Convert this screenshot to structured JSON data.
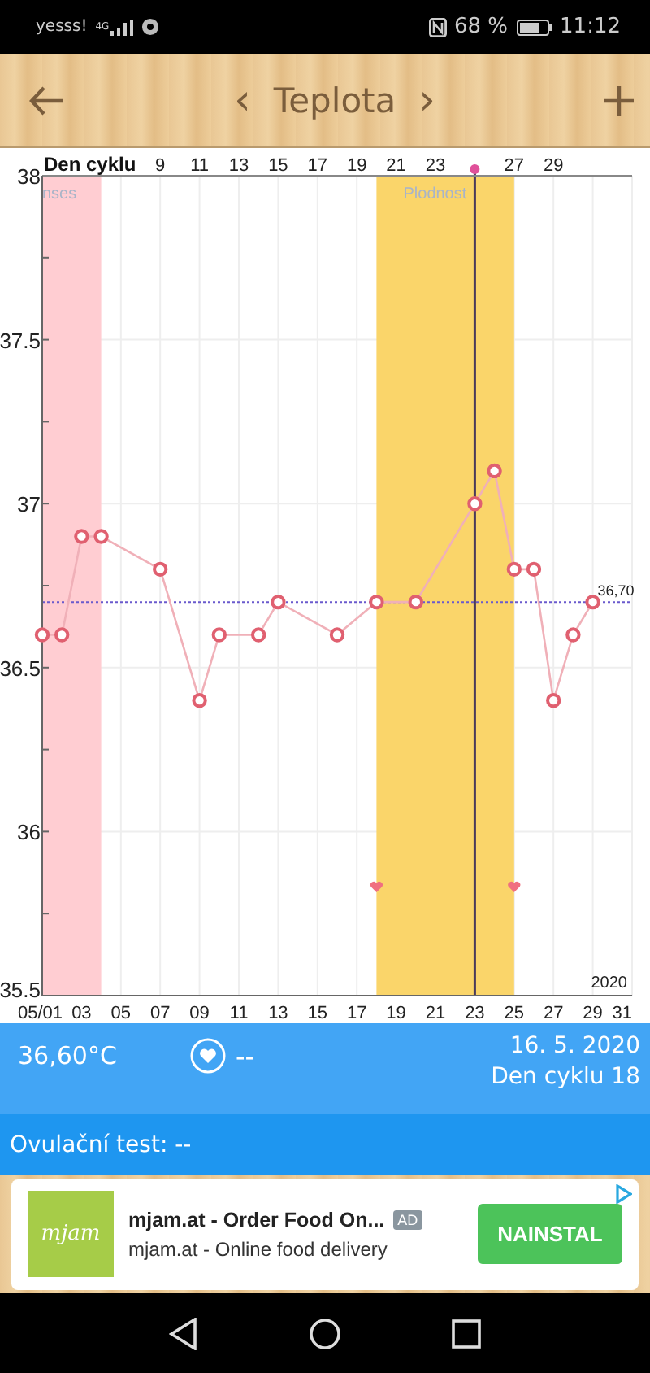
{
  "status_bar": {
    "carrier": "yesss!",
    "network": "4G",
    "battery": "68 %",
    "time": "11:12"
  },
  "header": {
    "title": "Teplota",
    "prev": "‹",
    "next": "›"
  },
  "chart": {
    "chart_data": {
      "type": "line",
      "title": "Den cyklu",
      "x": [
        1,
        2,
        3,
        4,
        7,
        9,
        10,
        12,
        13,
        16,
        18,
        20,
        23,
        24,
        25,
        26,
        27,
        28,
        29
      ],
      "series": [
        {
          "color": "#e06070",
          "marker": "circle",
          "values": [
            36.6,
            36.6,
            36.9,
            36.9,
            36.8,
            36.4,
            36.6,
            36.6,
            36.7,
            36.6,
            36.7,
            36.7,
            37.0,
            37.1,
            36.8,
            36.8,
            36.4,
            36.6,
            36.7
          ]
        },
        {
          "color": "#f07080",
          "type": "scatter",
          "values": [
            null,
            null,
            null,
            null,
            null,
            null,
            null,
            null,
            null,
            null,
            35.83,
            null,
            null,
            null,
            35.83,
            null,
            null,
            null,
            null
          ]
        }
      ],
      "grid": true,
      "xlim": [
        1,
        31
      ],
      "ylim": [
        35.5,
        38
      ],
      "xticks": [
        {
          "value": 1,
          "label": "05/01"
        },
        {
          "value": 3,
          "label": "03"
        },
        {
          "value": 5,
          "label": "05"
        },
        {
          "value": 7,
          "label": "07"
        },
        {
          "value": 9,
          "label": "09"
        },
        {
          "value": 11,
          "label": "11"
        },
        {
          "value": 13,
          "label": "13"
        },
        {
          "value": 15,
          "label": "15"
        },
        {
          "value": 17,
          "label": "17"
        },
        {
          "value": 19,
          "label": "19"
        },
        {
          "value": 21,
          "label": "21"
        },
        {
          "value": 23,
          "label": "23"
        },
        {
          "value": 25,
          "label": "25"
        },
        {
          "value": 27,
          "label": "27"
        },
        {
          "value": 29,
          "label": "29"
        },
        {
          "value": 31,
          "label": "31"
        }
      ],
      "yticks": [
        {
          "value": 35.5,
          "label": "35.5"
        },
        {
          "value": 36,
          "label": "36"
        },
        {
          "value": 36.5,
          "label": "36.5"
        },
        {
          "value": 37,
          "label": "37"
        },
        {
          "value": 37.5,
          "label": "37.5"
        },
        {
          "value": 38,
          "label": "38"
        }
      ],
      "bands": [
        {
          "axis": "x",
          "from": 1,
          "to": 4,
          "color": "#ffcdd2",
          "label": "nses"
        },
        {
          "axis": "x",
          "from": 18,
          "to": 25,
          "color": "#fad56a",
          "label": "Plodnost"
        }
      ],
      "ref_lines": [
        {
          "axis": "y",
          "value": 36.7,
          "label": "36,70",
          "color": "#6a5acd"
        },
        {
          "axis": "x",
          "value": 23,
          "color": "#4a3a5a"
        }
      ],
      "annotations": [
        "2020"
      ]
    },
    "cycle_axis": {
      "labels_before_marker": [
        "9",
        "11",
        "13",
        "15",
        "17",
        "19",
        "21",
        "23"
      ],
      "labels_after_marker": [
        "27",
        "29"
      ]
    }
  },
  "day_info": {
    "temperature": "36,60°C",
    "intercourse": "--",
    "date": "16. 5. 2020",
    "cycle_day": "Den cyklu 18"
  },
  "ovulation": {
    "label": "Ovulační test: --"
  },
  "ad": {
    "logo": "mjam",
    "title": "mjam.at - Order Food On...",
    "badge": "AD",
    "subtitle": "mjam.at - Online food delivery",
    "button": "NAINSTAL"
  }
}
